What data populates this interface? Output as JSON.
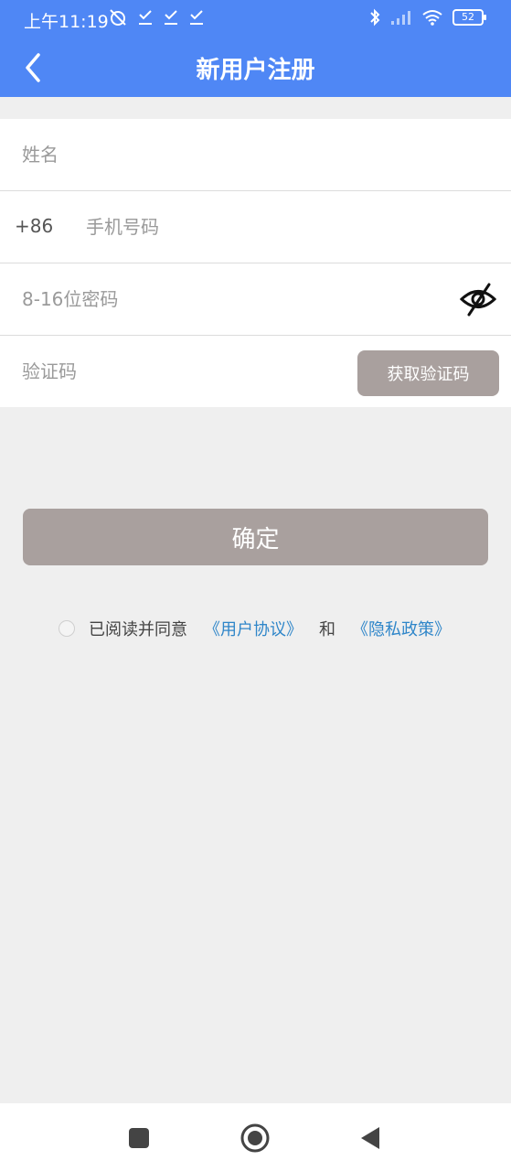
{
  "status_bar": {
    "time": "上午11:19",
    "battery_level": "52"
  },
  "header": {
    "title": "新用户注册"
  },
  "form": {
    "name": {
      "placeholder": "姓名"
    },
    "phone": {
      "country_code": "+86",
      "placeholder": "手机号码"
    },
    "password": {
      "placeholder": "8-16位密码"
    },
    "verification": {
      "placeholder": "验证码",
      "button_label": "获取验证码"
    }
  },
  "confirm_label": "确定",
  "agreement": {
    "prefix": "已阅读并同意",
    "user_agreement": "《用户协议》",
    "and": "和",
    "privacy_policy": "《隐私政策》"
  },
  "colors": {
    "header": "#4f87f5",
    "button": "#a9a09e",
    "link": "#2f86c9",
    "background": "#efefef"
  },
  "icons": [
    "back-arrow-icon",
    "eye-off-icon",
    "recents-icon",
    "home-icon",
    "back-triangle-icon"
  ]
}
